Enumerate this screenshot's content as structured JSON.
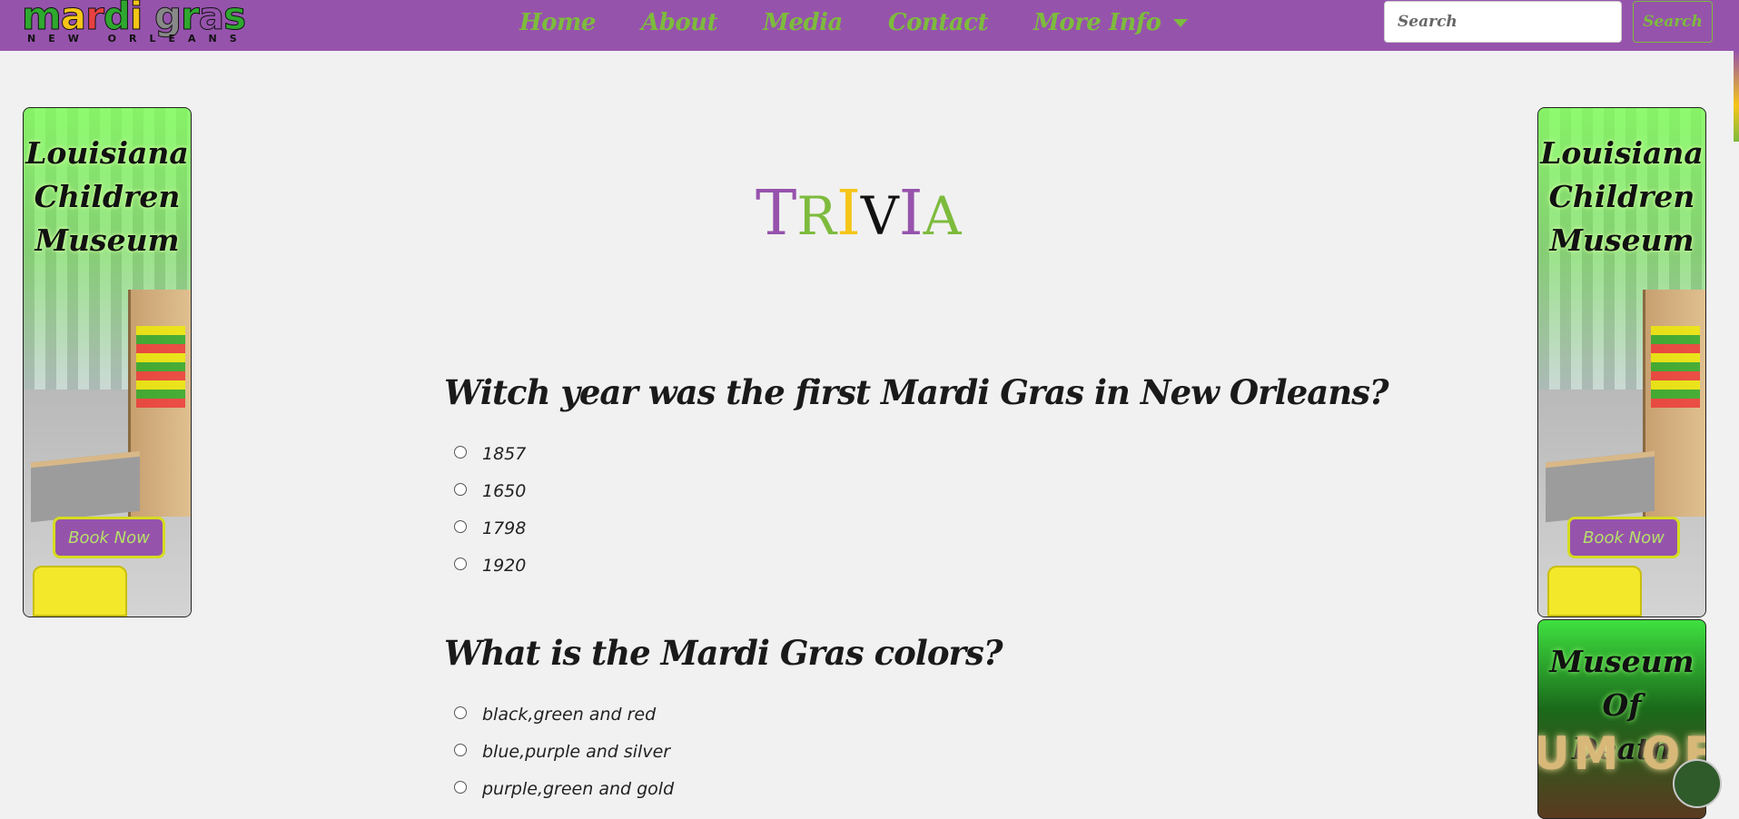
{
  "navbar": {
    "logo": {
      "top": "mardi gras",
      "sub": "NEW ORLEANS"
    },
    "links": [
      {
        "label": "Home"
      },
      {
        "label": "About"
      },
      {
        "label": "Media"
      },
      {
        "label": "Contact"
      },
      {
        "label": "More Info"
      }
    ],
    "search": {
      "placeholder": "Search",
      "button_label": "Search"
    }
  },
  "ads": {
    "left": {
      "title_lines": [
        "Louisiana",
        "Children",
        "Museum"
      ],
      "button_label": "Book Now"
    },
    "right": {
      "title_lines": [
        "Louisiana",
        "Children",
        "Museum"
      ],
      "button_label": "Book Now"
    },
    "right_second": {
      "title_lines": [
        "Museum Of",
        "Death"
      ],
      "sign_text": "UM OF"
    }
  },
  "main": {
    "title_letters": [
      "T",
      "R",
      "I",
      "V",
      "I",
      "A"
    ],
    "questions": [
      {
        "text": "Witch year was the first Mardi Gras in New Orleans?",
        "options": [
          "1857",
          "1650",
          "1798",
          "1920"
        ]
      },
      {
        "text": "What is the Mardi Gras colors?",
        "options": [
          "black,green and red",
          "blue,purple and silver",
          "purple,green and gold"
        ]
      }
    ]
  },
  "colors": {
    "purple": "#9653ac",
    "green": "#7dbb3d",
    "gold": "#f5c518",
    "background": "#f1f1f1"
  }
}
